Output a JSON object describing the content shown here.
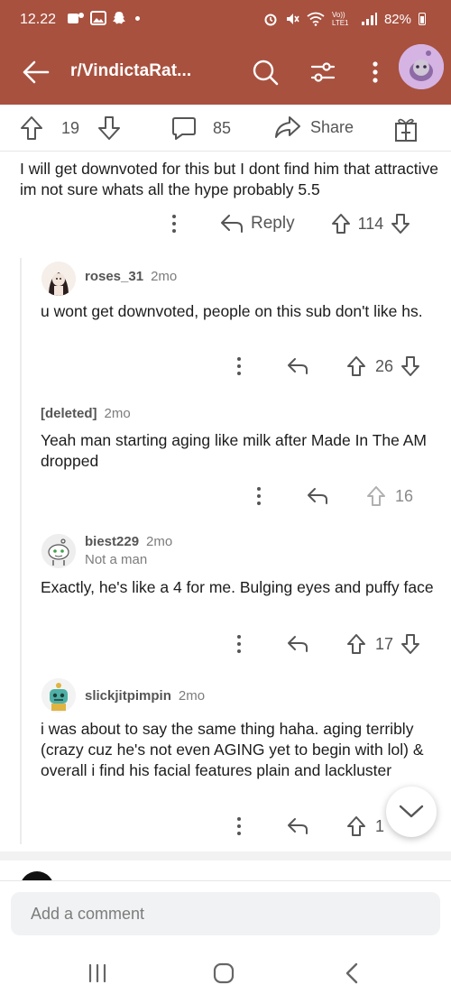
{
  "status": {
    "time": "12.22",
    "network": "Vo)) LTE1",
    "battery": "82%"
  },
  "header": {
    "subreddit": "r/VindictaRat..."
  },
  "post_actions": {
    "upvotes": "19",
    "comments": "85",
    "share_label": "Share"
  },
  "top_comment": {
    "text": "I will get downvoted for this but I dont find him that attractive im not sure whats all the hype probably 5.5",
    "reply_label": "Reply",
    "score": "114"
  },
  "replies": [
    {
      "username": "roses_31",
      "age": "2mo",
      "text": "u wont get downvoted, people on this sub don't like hs.",
      "score": "26"
    },
    {
      "username": "[deleted]",
      "age": "2mo",
      "text": "Yeah man starting aging like milk after Made In The AM dropped",
      "score": "16"
    },
    {
      "username": "biest229",
      "age": "2mo",
      "flair": "Not a man",
      "text": "Exactly, he's like a 4 for me. Bulging eyes and puffy face",
      "score": "17"
    },
    {
      "username": "slickjitpimpin",
      "age": "2mo",
      "text": "i was about to say the same thing haha. aging terribly (crazy cuz he's not even AGING yet to begin with lol) & overall i find his facial features plain and lackluster",
      "score": "1"
    }
  ],
  "composer": {
    "placeholder": "Add a comment"
  },
  "colors": {
    "header_bg": "#a8513f",
    "text": "#1c1c1c",
    "muted": "#7c7c7c"
  }
}
